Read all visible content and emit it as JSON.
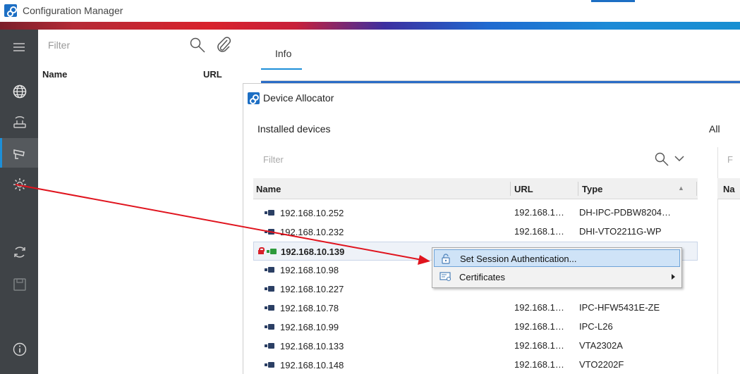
{
  "app": {
    "title": "Configuration Manager"
  },
  "left_panel": {
    "filter_placeholder": "Filter",
    "col_name": "Name",
    "col_url": "URL"
  },
  "main": {
    "tab_info": "Info"
  },
  "dialog": {
    "title": "Device Allocator",
    "installed_label": "Installed devices",
    "all_label_fragment": "All",
    "filter_placeholder": "Filter",
    "right_filter_fragment": "F",
    "columns": {
      "name": "Name",
      "url": "URL",
      "type": "Type",
      "right_name_fragment": "Na"
    },
    "rows": [
      {
        "name": "192.168.10.252",
        "url": "192.168.1…",
        "type": "DH-IPC-PDBW8204…",
        "locked": false,
        "online": false
      },
      {
        "name": "192.168.10.232",
        "url": "192.168.1…",
        "type": "DHI-VTO2211G-WP",
        "locked": false,
        "online": false
      },
      {
        "name": "192.168.10.139",
        "url": "",
        "type": "",
        "locked": true,
        "online": true,
        "selected": true
      },
      {
        "name": "192.168.10.98",
        "url": "",
        "type": "",
        "locked": false,
        "online": false
      },
      {
        "name": "192.168.10.227",
        "url": "",
        "type": "",
        "locked": false,
        "online": false
      },
      {
        "name": "192.168.10.78",
        "url": "192.168.1…",
        "type": "IPC-HFW5431E-ZE",
        "locked": false,
        "online": false
      },
      {
        "name": "192.168.10.99",
        "url": "192.168.1…",
        "type": "IPC-L26",
        "locked": false,
        "online": false
      },
      {
        "name": "192.168.10.133",
        "url": "192.168.1…",
        "type": "VTA2302A",
        "locked": false,
        "online": false
      },
      {
        "name": "192.168.10.148",
        "url": "192.168.1…",
        "type": "VTO2202F",
        "locked": false,
        "online": false
      }
    ]
  },
  "context_menu": {
    "items": [
      {
        "label": "Set Session Authentication...",
        "icon": "lock-icon",
        "highlighted": true
      },
      {
        "label": "Certificates",
        "icon": "certificate-icon",
        "submenu": true
      }
    ]
  },
  "colors": {
    "accent": "#1d8fd8",
    "nav_bg": "#3f4347",
    "annotation_arrow": "#e0141e",
    "lock": "#d8202a"
  }
}
